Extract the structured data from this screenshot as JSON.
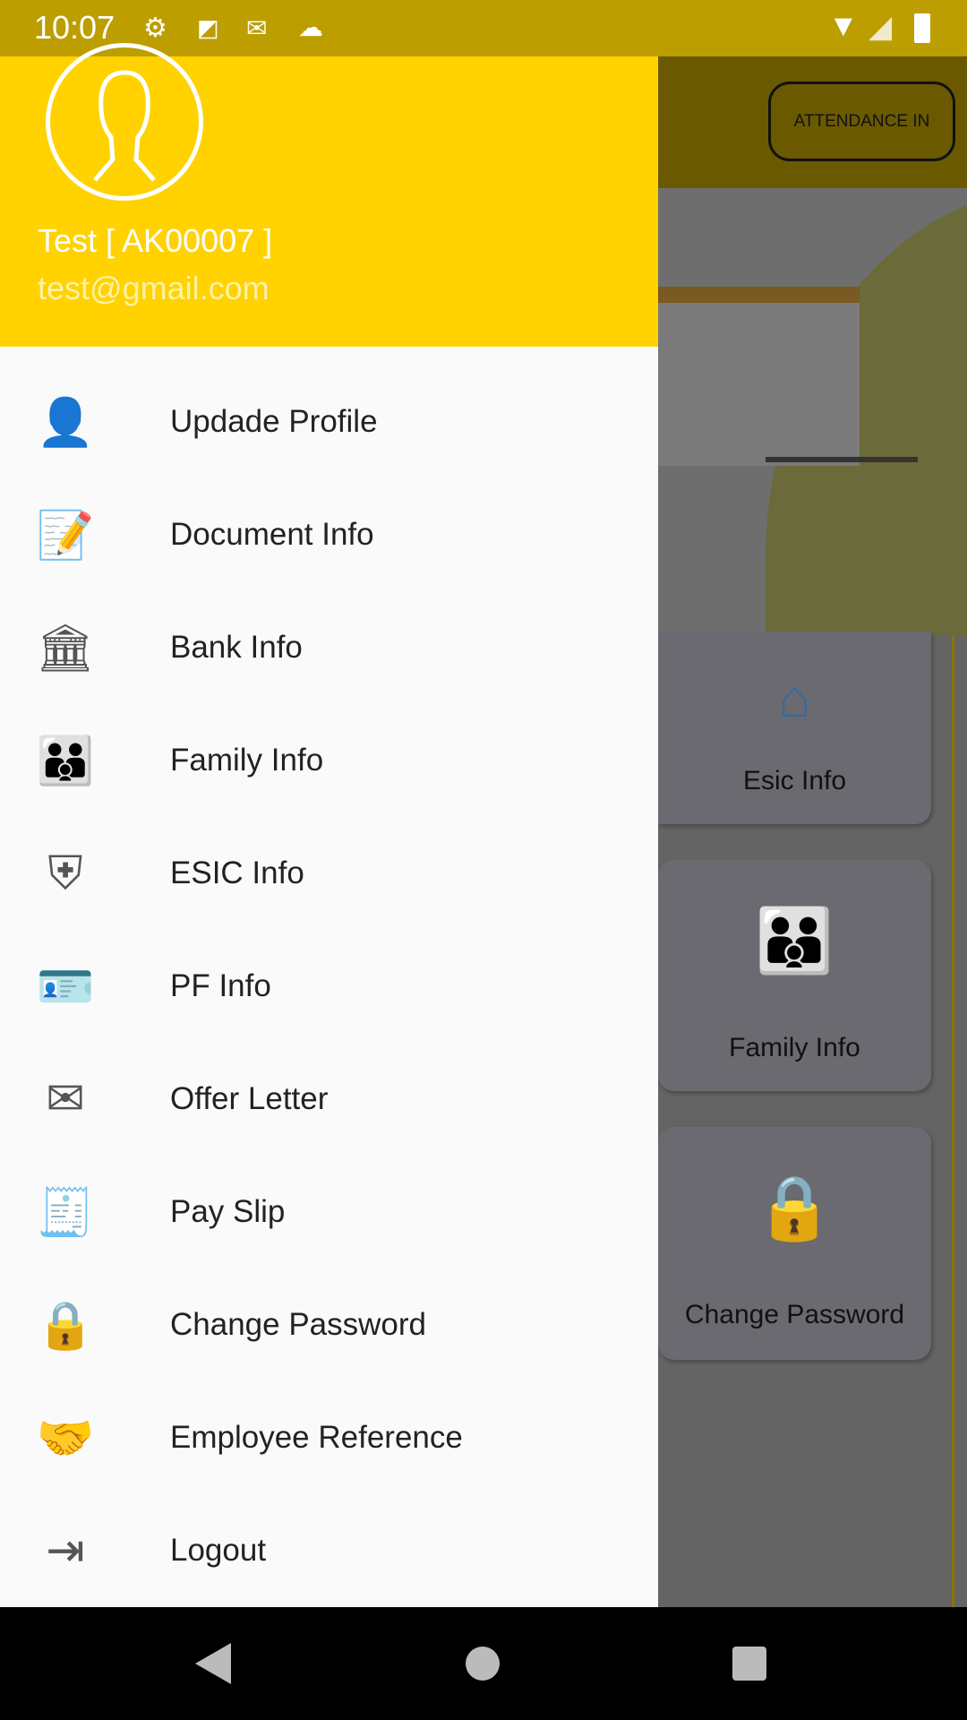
{
  "status_bar": {
    "time": "10:07",
    "icons": [
      "gear-icon",
      "maps-icon",
      "gmail-icon",
      "cloud-icon",
      "wifi-icon",
      "signal-icon",
      "battery-icon"
    ]
  },
  "background": {
    "attendance_button": "ATTENDANCE IN",
    "cards": [
      "Esic Info",
      "Family Info",
      "Change Password"
    ]
  },
  "drawer": {
    "user_name": "Test [ AK00007 ]",
    "user_email": "test@gmail.com",
    "items": [
      {
        "label": "Updade Profile",
        "icon": "person-icon"
      },
      {
        "label": "Document Info",
        "icon": "document-edit-icon"
      },
      {
        "label": "Bank Info",
        "icon": "bank-icon"
      },
      {
        "label": "Family Info",
        "icon": "family-icon"
      },
      {
        "label": "ESIC Info",
        "icon": "shield-hands-icon"
      },
      {
        "label": "PF Info",
        "icon": "id-card-icon"
      },
      {
        "label": "Offer Letter",
        "icon": "envelope-letter-icon"
      },
      {
        "label": "Pay Slip",
        "icon": "receipt-icon"
      },
      {
        "label": "Change Password",
        "icon": "lock-password-icon"
      },
      {
        "label": "Employee Reference",
        "icon": "handshake-icon"
      },
      {
        "label": "Logout",
        "icon": "logout-icon"
      }
    ]
  },
  "colors": {
    "header": "#ffd200",
    "status_bar": "#bc9e00"
  }
}
